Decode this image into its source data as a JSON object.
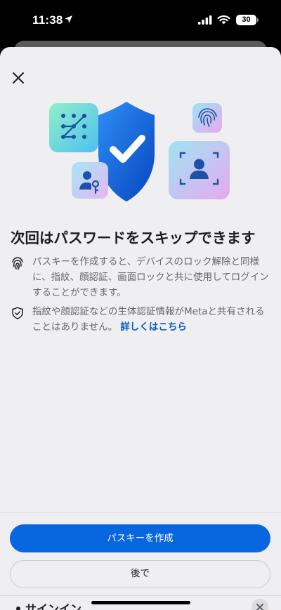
{
  "status_bar": {
    "time": "11:38",
    "battery": "30"
  },
  "sheet": {
    "title": "次回はパスワードをスキップできます",
    "info": [
      {
        "icon": "fingerprint-icon",
        "text": "パスキーを作成すると、デバイスのロック解除と同様に、指紋、顔認証、画面ロックと共に使用してログインすることができます。"
      },
      {
        "icon": "shield-check-icon",
        "text": "指紋や顔認証などの生体認証情報がMetaと共有されることはありません。",
        "link": "詳しくはこちら"
      }
    ],
    "primary_button": "パスキーを作成",
    "secondary_button": "後で"
  },
  "peek_sheet": {
    "title": "サインイン"
  },
  "colors": {
    "accent": "#0866e0",
    "link": "#0a5ac2",
    "background": "#efeff1",
    "text": "#1c1e21",
    "muted": "#65676b"
  }
}
